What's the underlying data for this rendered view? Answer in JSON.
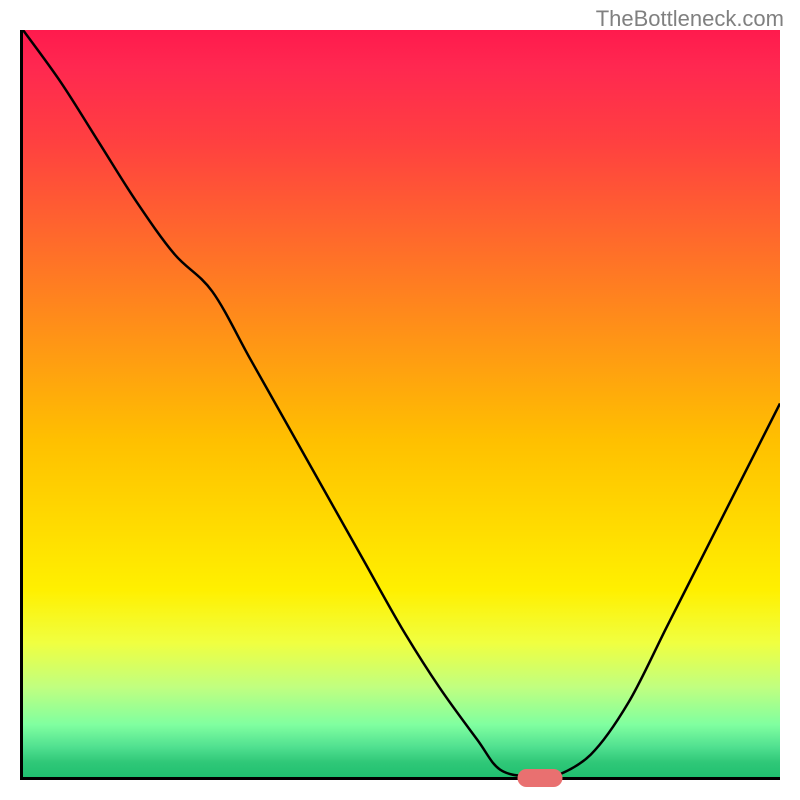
{
  "watermark": "TheBottleneck.com",
  "chart_data": {
    "type": "line",
    "title": "",
    "xlabel": "",
    "ylabel": "",
    "xlim": [
      0,
      100
    ],
    "ylim": [
      0,
      100
    ],
    "grid": false,
    "x": [
      0,
      5,
      10,
      15,
      20,
      25,
      30,
      35,
      40,
      45,
      50,
      55,
      60,
      63,
      67,
      70,
      75,
      80,
      85,
      90,
      95,
      100
    ],
    "y": [
      100,
      93,
      85,
      77,
      70,
      65,
      56,
      47,
      38,
      29,
      20,
      12,
      5,
      1,
      0,
      0,
      3,
      10,
      20,
      30,
      40,
      50
    ],
    "marker": {
      "x": 68,
      "y": 0
    }
  }
}
